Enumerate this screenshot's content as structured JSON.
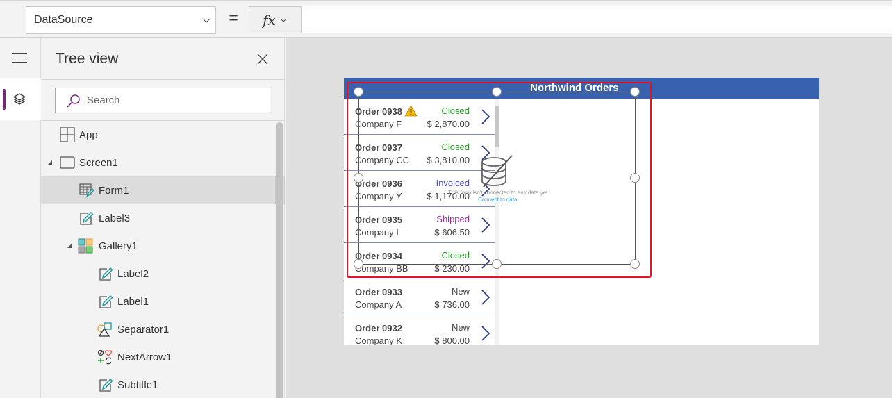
{
  "formula_bar": {
    "property": "DataSource",
    "equals": "=",
    "fx_label": "fx",
    "formula": ""
  },
  "rail": {
    "menu_icon": "hamburger-icon",
    "layers_icon": "layers-icon",
    "accent": "#742774"
  },
  "tree_view": {
    "title": "Tree view",
    "search_placeholder": "Search",
    "items": [
      {
        "label": "App",
        "icon": "app-icon",
        "level": 0,
        "expandable": false,
        "selected": false
      },
      {
        "label": "Screen1",
        "icon": "screen-icon",
        "level": 0,
        "expandable": true,
        "selected": false
      },
      {
        "label": "Form1",
        "icon": "form-icon",
        "level": 1,
        "expandable": false,
        "selected": true
      },
      {
        "label": "Label3",
        "icon": "label-icon",
        "level": 1,
        "expandable": false,
        "selected": false
      },
      {
        "label": "Gallery1",
        "icon": "gallery-icon",
        "level": 1,
        "expandable": true,
        "selected": false
      },
      {
        "label": "Label2",
        "icon": "label-icon",
        "level": 2,
        "expandable": false,
        "selected": false
      },
      {
        "label": "Label1",
        "icon": "label-icon",
        "level": 2,
        "expandable": false,
        "selected": false
      },
      {
        "label": "Separator1",
        "icon": "shapes-icon",
        "level": 2,
        "expandable": false,
        "selected": false
      },
      {
        "label": "NextArrow1",
        "icon": "icons-icon",
        "level": 2,
        "expandable": false,
        "selected": false
      },
      {
        "label": "Subtitle1",
        "icon": "label-icon",
        "level": 2,
        "expandable": false,
        "selected": false
      }
    ]
  },
  "app": {
    "title": "Northwind Orders",
    "header_color": "#3861b0",
    "orders": [
      {
        "order": "Order 0938",
        "company": "Company F",
        "status": "Closed",
        "status_color": "#2a9a2a",
        "amount": "$ 2,870.00",
        "warning": true
      },
      {
        "order": "Order 0937",
        "company": "Company CC",
        "status": "Closed",
        "status_color": "#2a9a2a",
        "amount": "$ 3,810.00",
        "warning": false
      },
      {
        "order": "Order 0936",
        "company": "Company Y",
        "status": "Invoiced",
        "status_color": "#4b4bdc",
        "amount": "$ 1,170.00",
        "warning": false
      },
      {
        "order": "Order 0935",
        "company": "Company I",
        "status": "Shipped",
        "status_color": "#a030a0",
        "amount": "$ 606.50",
        "warning": false
      },
      {
        "order": "Order 0934",
        "company": "Company BB",
        "status": "Closed",
        "status_color": "#2a9a2a",
        "amount": "$ 230.00",
        "warning": false
      },
      {
        "order": "Order 0933",
        "company": "Company A",
        "status": "New",
        "status_color": "#444444",
        "amount": "$ 736.00",
        "warning": false
      },
      {
        "order": "Order 0932",
        "company": "Company K",
        "status": "New",
        "status_color": "#444444",
        "amount": "$ 800.00",
        "warning": false
      }
    ],
    "form": {
      "empty_message": "This form isn't connected to any data yet",
      "connect_link": "Connect to data"
    }
  }
}
